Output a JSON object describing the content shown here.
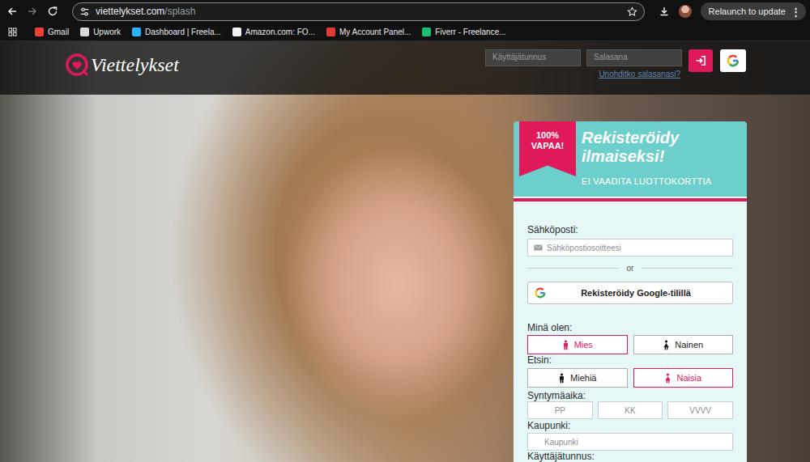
{
  "browser": {
    "url_domain": "viettelykset.com",
    "url_path": "/splash",
    "relaunch": "Relaunch to update",
    "menu": "⋮"
  },
  "bookmarks": [
    {
      "label": "Gmail",
      "color": "#ea4335"
    },
    {
      "label": "Upwork",
      "color": "#d9d9d9"
    },
    {
      "label": "Dashboard | Freela...",
      "color": "#29b2fe"
    },
    {
      "label": "Amazon.com: FO...",
      "color": "#f2f2f2"
    },
    {
      "label": "My Account Panel...",
      "color": "#e53935"
    },
    {
      "label": "Fiverr - Freelance...",
      "color": "#1dbf73"
    }
  ],
  "header": {
    "logo": "Viettelykset",
    "username_placeholder": "Käyttäjätunnus",
    "password_placeholder": "Salasana",
    "forgot": "Unohditko salasanasi?"
  },
  "signup": {
    "badge_lines": [
      "100%",
      "VAPAA!"
    ],
    "title_lines": [
      "Rekisteröidy",
      "ilmaiseksi!"
    ],
    "subtitle": "EI VAADITA LUOTTOKORTTIA",
    "email_label": "Sähköposti:",
    "email_placeholder": "Sähköpostiosoitteesi",
    "or": "or",
    "google_button": "Rekisteröidy Google-tilillä",
    "gender_label": "Minä olen:",
    "gender_options": [
      {
        "label": "Mies",
        "kind": "male",
        "selected": true
      },
      {
        "label": "Nainen",
        "kind": "female",
        "selected": false
      }
    ],
    "seeking_label": "Etsin:",
    "seeking_options": [
      {
        "label": "Miehiä",
        "kind": "male",
        "selected": false
      },
      {
        "label": "Naisia",
        "kind": "female",
        "selected": true
      }
    ],
    "birth_label": "Syntymäaika:",
    "birth_fields": [
      "PP",
      "KK",
      "VVVV"
    ],
    "city_label": "Kaupunki:",
    "city_placeholder": "Kaupunki",
    "username_label": "Käyttäjätunnus:"
  }
}
